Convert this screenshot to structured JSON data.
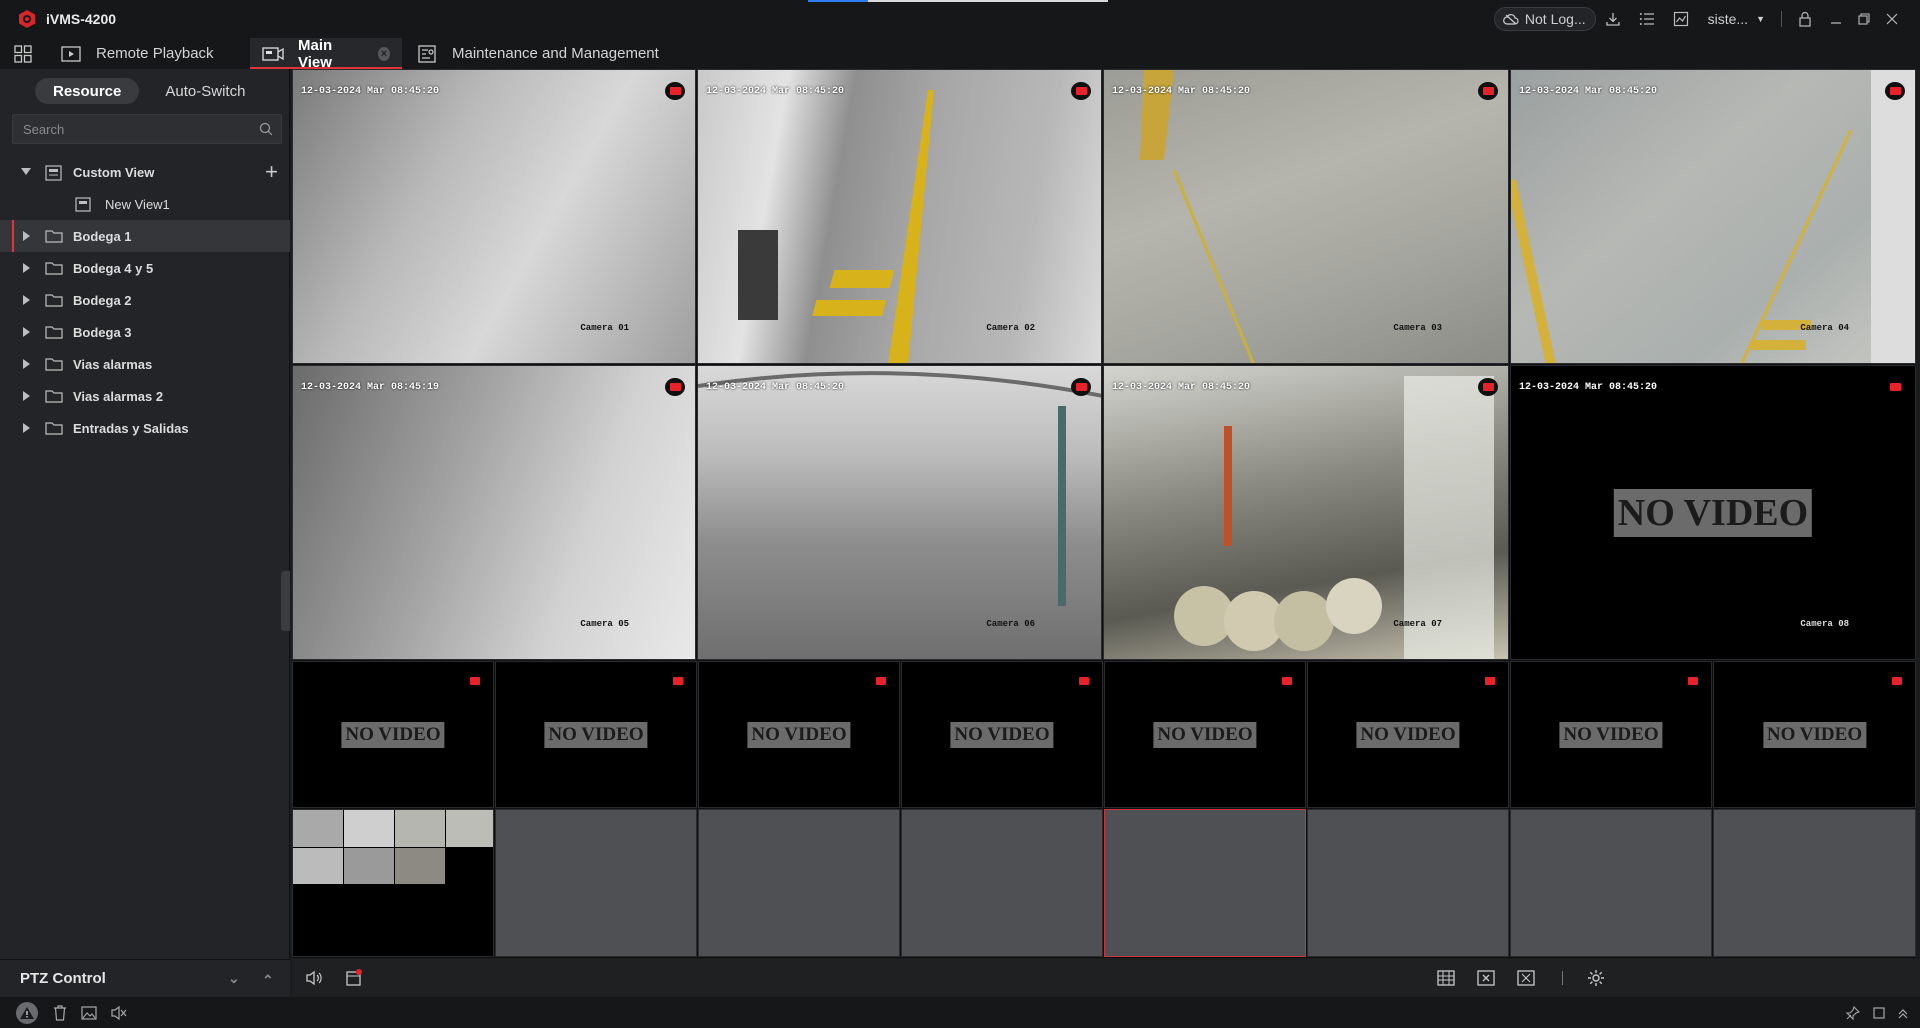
{
  "app": {
    "title": "iVMS-4200"
  },
  "titlebar": {
    "cloud_label": "Not Log...",
    "user_label": "siste..."
  },
  "tabs": [
    {
      "label": "Remote Playback"
    },
    {
      "label": "Main View",
      "active": true
    },
    {
      "label": "Maintenance and Management"
    }
  ],
  "sidebar": {
    "segment": {
      "resource": "Resource",
      "auto_switch": "Auto-Switch"
    },
    "search_placeholder": "Search",
    "tree": {
      "custom_view": "Custom View",
      "new_view": "New View1",
      "groups": [
        "Bodega 1",
        "Bodega 4 y 5",
        "Bodega 2",
        "Bodega 3",
        "Vias alarmas",
        "Vias alarmas 2",
        "Entradas y Salidas"
      ],
      "selected": "Bodega 1"
    },
    "ptz_label": "PTZ Control"
  },
  "cameras": [
    {
      "timestamp": "12-03-2024 Mar 08:45:20",
      "name": "Camera 01"
    },
    {
      "timestamp": "12-03-2024 Mar 08:45:20",
      "name": "Camera 02"
    },
    {
      "timestamp": "12-03-2024 Mar 08:45:20",
      "name": "Camera 03"
    },
    {
      "timestamp": "12-03-2024 Mar 08:45:20",
      "name": "Camera 04"
    },
    {
      "timestamp": "12-03-2024 Mar 08:45:19",
      "name": "Camera 05"
    },
    {
      "timestamp": "12-03-2024 Mar 08:45:20",
      "name": "Camera 06"
    },
    {
      "timestamp": "12-03-2024 Mar 08:45:20",
      "name": "Camera 07"
    },
    {
      "timestamp": "12-03-2024 Mar 08:45:20",
      "name": "Camera 08",
      "no_video": "NO VIDEO"
    }
  ],
  "small_cells": [
    {
      "no_video": "NO VIDEO"
    },
    {
      "no_video": "NO VIDEO"
    },
    {
      "no_video": "NO VIDEO"
    },
    {
      "no_video": "NO VIDEO"
    },
    {
      "no_video": "NO VIDEO"
    },
    {
      "no_video": "NO VIDEO"
    },
    {
      "no_video": "NO VIDEO"
    },
    {
      "no_video": "NO VIDEO"
    }
  ],
  "colors": {
    "accent": "#e2353b",
    "record": "#e8222b",
    "active_blue": "#2d7cf6"
  }
}
